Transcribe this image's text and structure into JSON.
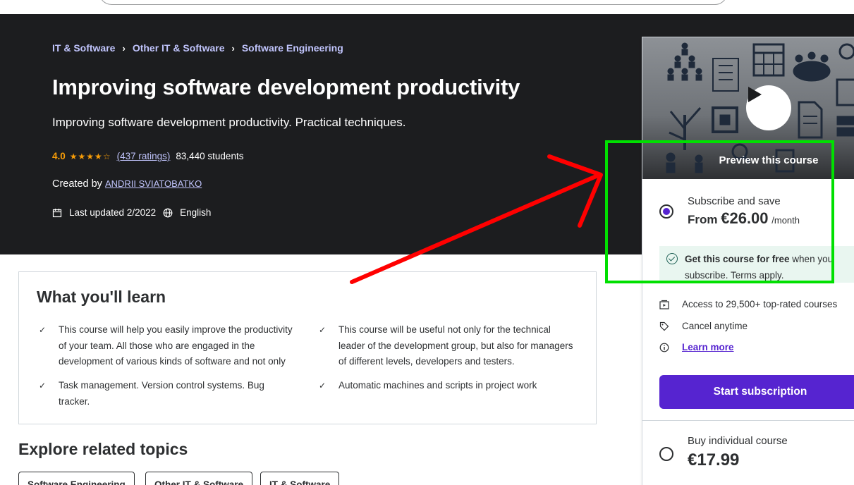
{
  "breadcrumb": [
    "IT & Software",
    "Other IT & Software",
    "Software Engineering"
  ],
  "course": {
    "title": "Improving software development productivity",
    "subtitle": "Improving software development productivity. Practical techniques.",
    "rating": "4.0",
    "stars": "★★★★☆",
    "ratings_link": "(437 ratings)",
    "students": "83,440 students",
    "created_by_label": "Created by",
    "author": "ANDRII SVIATOBATKO",
    "last_updated": "Last updated 2/2022",
    "language": "English"
  },
  "learn": {
    "title": "What you'll learn",
    "items": [
      "This course will help you easily improve the productivity of your team. All those who are engaged in the development of various kinds of software and not only",
      "This course will be useful not only for the technical leader of the development group, but also for managers of different levels, developers and testers.",
      "Task management. Version control systems. Bug tracker.",
      "Automatic machines and scripts in project work"
    ]
  },
  "explore": {
    "title": "Explore related topics",
    "topics": [
      "Software Engineering",
      "Other IT & Software",
      "IT & Software"
    ]
  },
  "sidebar": {
    "preview_label": "Preview this course",
    "subscribe_label": "Subscribe and save",
    "subscribe_from": "From",
    "subscribe_price": "€26.00",
    "subscribe_unit": "/month",
    "free_bold": "Get this course for free",
    "free_rest": " when you subscribe. Terms apply.",
    "features": [
      "Access to 29,500+ top-rated courses",
      "Cancel anytime",
      "Learn more"
    ],
    "start_button": "Start subscription",
    "buy_label": "Buy individual course",
    "buy_price": "€17.99"
  },
  "colors": {
    "hero_bg": "#1c1d1f",
    "accent_purple": "#5624d0",
    "link_lilac": "#c0c4fc",
    "star_orange": "#f69c08",
    "annotation_green": "#00e000",
    "annotation_red": "#ff0000"
  }
}
